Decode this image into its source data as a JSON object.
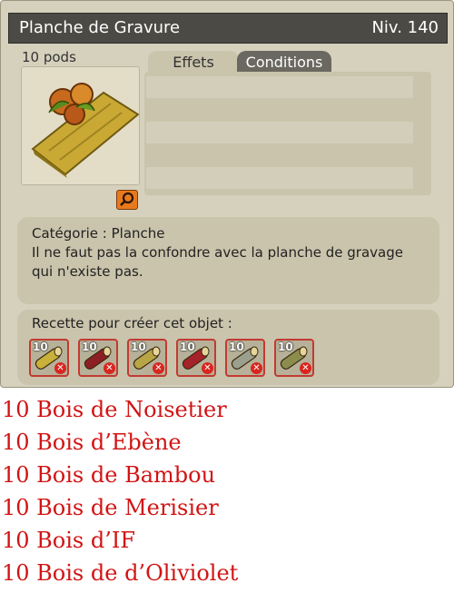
{
  "title_bar": {
    "name": "Planche de Gravure",
    "level": "Niv. 140"
  },
  "item": {
    "pods": "10 pods",
    "image": "wooden-plank-with-nuts-icon",
    "zoom_icon": "magnifier-icon"
  },
  "tabs": [
    {
      "label": "Effets",
      "active": false
    },
    {
      "label": "Conditions",
      "active": true
    }
  ],
  "description": {
    "category": "Catégorie : Planche",
    "text": "Il ne faut pas la confondre avec la planche de gravage qui n'existe pas."
  },
  "recipe": {
    "title": "Recette pour créer cet objet :",
    "ingredients": [
      {
        "qty": "10",
        "icon": "bois-noisetier-icon",
        "color": "#c9b13a"
      },
      {
        "qty": "10",
        "icon": "bois-ebene-icon",
        "color": "#8b1f24"
      },
      {
        "qty": "10",
        "icon": "bois-bambou-icon",
        "color": "#b8a646"
      },
      {
        "qty": "10",
        "icon": "bois-merisier-icon",
        "color": "#a5222a"
      },
      {
        "qty": "10",
        "icon": "bois-if-icon",
        "color": "#9aa08d"
      },
      {
        "qty": "10",
        "icon": "bois-oliviolet-icon",
        "color": "#8c8d4d"
      }
    ]
  },
  "resource_list": [
    "10 Bois de Noisetier",
    "10 Bois d’Ebène",
    "10 Bois de Bambou",
    "10 Bois de Merisier",
    "10 Bois d’IF",
    "10 Bois de d’Oliviolet"
  ],
  "colors": {
    "title_bg": "#4b4a44",
    "panel_bg": "#d6d1bd",
    "list_text": "#d11414",
    "missing_x": "#d8261f",
    "zoom_button": "#e8791d"
  }
}
